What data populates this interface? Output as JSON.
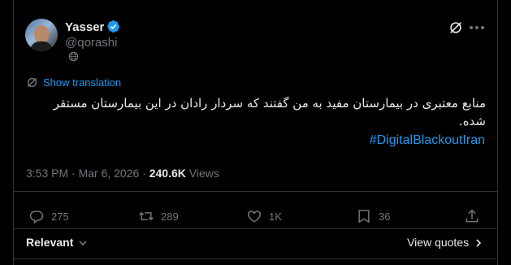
{
  "author": {
    "name": "Yasser",
    "handle": "@qorashi"
  },
  "translate_label": "Show translation",
  "tweet": {
    "text": "منابع معتبری در بیمارستان مفید به من گفتند که سردار رادان در این بیمارستان مستقر شده.",
    "hashtag": "#DigitalBlackoutIran"
  },
  "meta": {
    "time": "3:53 PM · Mar 6, 2026 · ",
    "views_count": "240.6K",
    "views_label": " Views"
  },
  "actions": {
    "replies": "275",
    "reposts": "289",
    "likes": "1K",
    "bookmarks": "36"
  },
  "footer": {
    "sort_label": "Relevant",
    "view_quotes": "View quotes"
  },
  "colors": {
    "accent": "#1d9bf0",
    "muted": "#71767b",
    "text": "#e7e9ea",
    "border": "#2f3336"
  }
}
